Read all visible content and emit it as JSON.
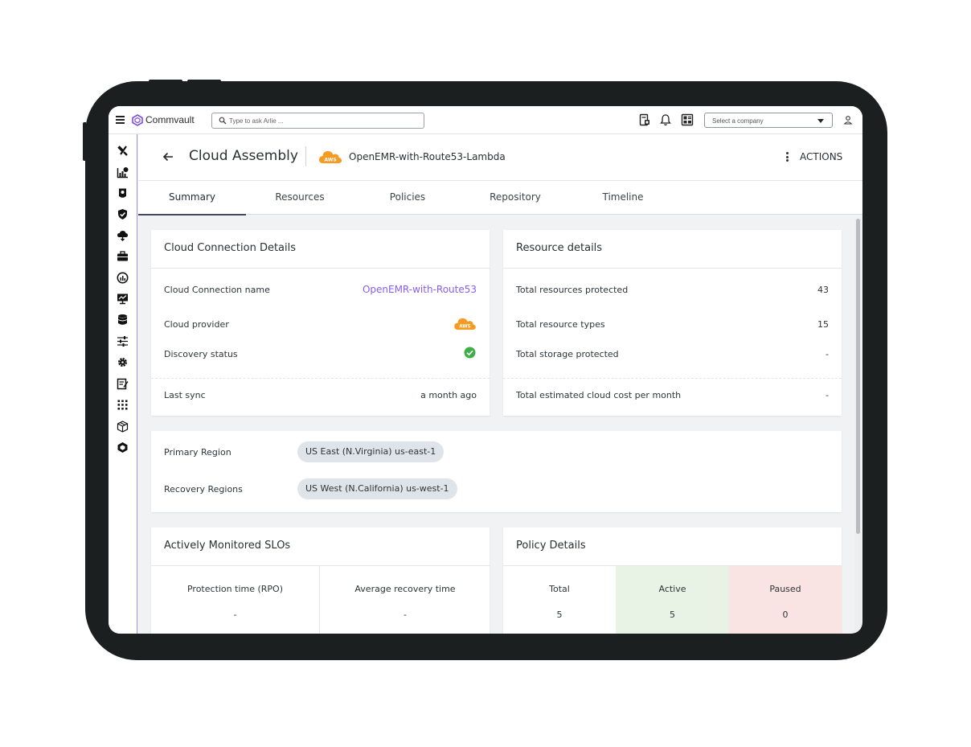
{
  "topbar": {
    "brand": "Commvault",
    "search_placeholder": "Type to ask Arlie ...",
    "company_select": "Select a company"
  },
  "header": {
    "title": "Cloud Assembly",
    "assembly_name": "OpenEMR-with-Route53-Lambda",
    "provider_badge": "AWS",
    "actions_label": "ACTIONS"
  },
  "tabs": [
    "Summary",
    "Resources",
    "Policies",
    "Repository",
    "Timeline"
  ],
  "active_tab": "Summary",
  "cloud_connection": {
    "title": "Cloud Connection Details",
    "name_label": "Cloud Connection name",
    "name_value": "OpenEMR-with-Route53",
    "provider_label": "Cloud provider",
    "provider_badge": "AWS",
    "discovery_label": "Discovery status",
    "last_sync_label": "Last sync",
    "last_sync_value": "a month ago"
  },
  "resource_details": {
    "title": "Resource details",
    "rows": [
      {
        "label": "Total resources protected",
        "value": "43"
      },
      {
        "label": "Total resource types",
        "value": "15"
      },
      {
        "label": "Total storage protected",
        "value": "-"
      },
      {
        "label": "Total estimated cloud cost per month",
        "value": "-"
      }
    ]
  },
  "regions": {
    "primary_label": "Primary Region",
    "primary_value": "US East (N.Virginia) us-east-1",
    "recovery_label": "Recovery Regions",
    "recovery_value": "US West (N.California) us-west-1"
  },
  "slos": {
    "title": "Actively Monitored SLOs",
    "items": [
      {
        "label": "Protection time (RPO)",
        "value": "-"
      },
      {
        "label": "Average recovery time",
        "value": "-"
      }
    ]
  },
  "policy_details": {
    "title": "Policy Details",
    "items": [
      {
        "label": "Total",
        "value": "5"
      },
      {
        "label": "Active",
        "value": "5"
      },
      {
        "label": "Paused",
        "value": "0"
      }
    ]
  },
  "colors": {
    "accent_link": "#8a5cf0",
    "aws_orange": "#f59a23",
    "success_green": "#3fae49",
    "active_cell": "#e8f3e6",
    "paused_cell": "#f9e3e3",
    "region_chip": "#dfe4ea"
  },
  "icons": {
    "leftnav": [
      "tools-icon",
      "reports-icon",
      "guides-icon",
      "protect-shield-icon",
      "cloud-icon",
      "jobs-briefcase-icon",
      "dashboard-gauge-icon",
      "monitoring-icon",
      "storage-db-icon",
      "manage-sliders-icon",
      "settings-gear-icon",
      "forms-icon",
      "apps-grid-icon",
      "assemblies-cubes-icon",
      "commvault-hex-icon"
    ]
  }
}
